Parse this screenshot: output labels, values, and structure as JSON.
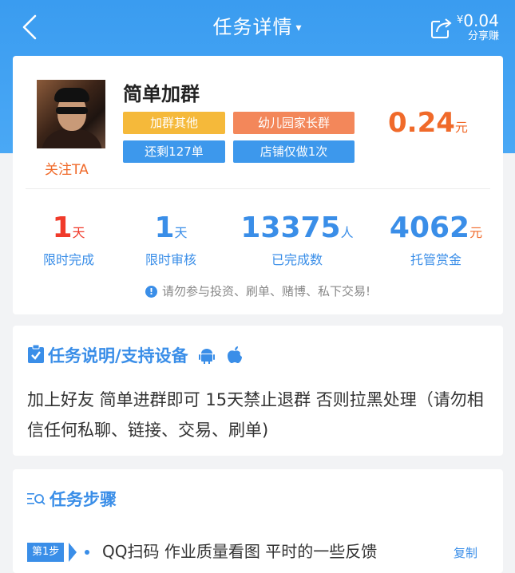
{
  "header": {
    "title": "任务详情",
    "caret": "▾",
    "share_amount": "0.04",
    "share_currency": "¥",
    "share_label": "分享赚"
  },
  "publisher": {
    "follow_label": "关注TA"
  },
  "task": {
    "name": "简单加群",
    "tags": [
      "加群其他",
      "幼儿园家长群",
      "还剩127单",
      "店铺仅做1次"
    ],
    "reward_value": "0.24",
    "reward_unit": "元"
  },
  "stats": [
    {
      "value": "1",
      "unit": "天",
      "label": "限时完成"
    },
    {
      "value": "1",
      "unit": "天",
      "label": "限时审核"
    },
    {
      "value": "13375",
      "unit": "人",
      "label": "已完成数"
    },
    {
      "value": "4062",
      "unit": "元",
      "label": "托管赏金"
    }
  ],
  "warning": {
    "icon": "!",
    "text": "请勿参与投资、刷单、赌博、私下交易!"
  },
  "description": {
    "title": "任务说明/支持设备",
    "text": "加上好友 简单进群即可 15天禁止退群 否则拉黑处理（请勿相信任何私聊、链接、交易、刷单)"
  },
  "steps": {
    "title": "任务步骤",
    "items": [
      {
        "badge": "第1步",
        "text": "QQ扫码 作业质量看图 平时的一些反馈",
        "action": "复制"
      }
    ]
  },
  "colors": {
    "brand_blue": "#3a8ee8",
    "accent_orange": "#f06a2a",
    "red": "#f03a2a",
    "header_blue": "#4aa8f5"
  }
}
